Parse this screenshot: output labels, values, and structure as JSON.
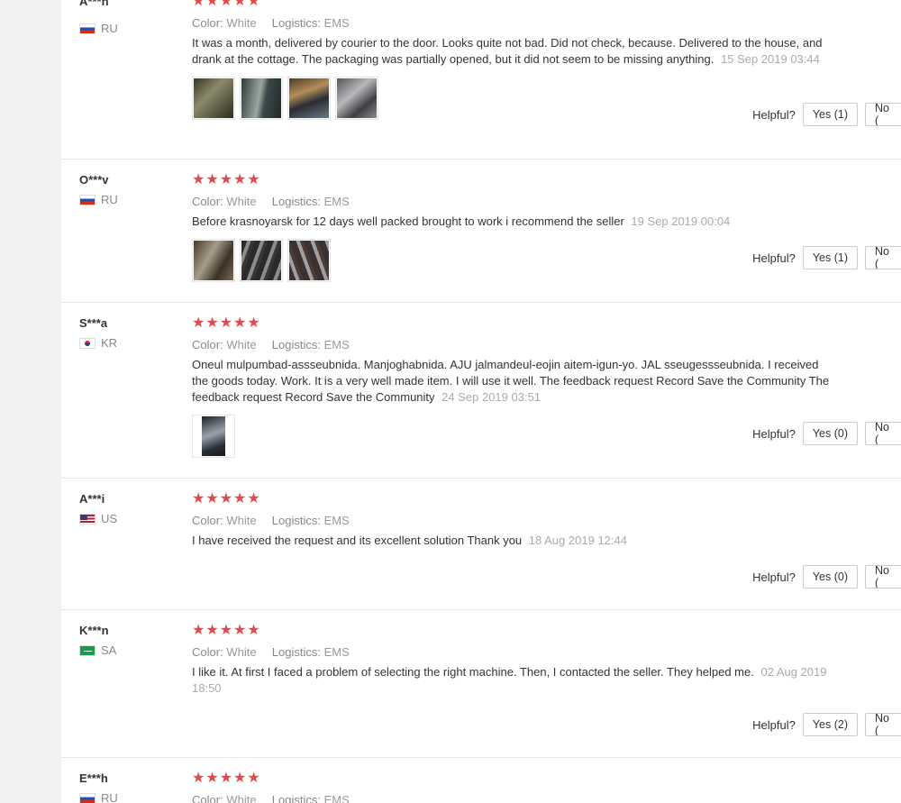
{
  "reviews": [
    {
      "user": "A***n",
      "country": "RU",
      "flag": "ru",
      "stars": "★★★★★",
      "color_label": "Color:",
      "color_value": "White",
      "logistics_label": "Logistics:",
      "logistics_value": "EMS",
      "text": "It was a month, delivered by courier to the door. Looks quite not bad. Did not check, because. Delivered to the house, and drank at the cottage. The packaging was partially opened, but it did not seem to be missing anything.",
      "date": "15 Sep 2019 03:44",
      "photos": 4,
      "helpful_label": "Helpful?",
      "yes": "Yes (1)",
      "no": "No ("
    },
    {
      "user": "O***v",
      "country": "RU",
      "flag": "ru",
      "stars": "★★★★★",
      "color_label": "Color:",
      "color_value": "White",
      "logistics_label": "Logistics:",
      "logistics_value": "EMS",
      "text": "Before krasnoyarsk for 12 days well packed brought to work i recommend the seller",
      "date": "19 Sep 2019 00:04",
      "photos": 3,
      "helpful_label": "Helpful?",
      "yes": "Yes (1)",
      "no": "No ("
    },
    {
      "user": "S***a",
      "country": "KR",
      "flag": "kr",
      "stars": "★★★★★",
      "color_label": "Color:",
      "color_value": "White",
      "logistics_label": "Logistics:",
      "logistics_value": "EMS",
      "text": "Oneul mulpumbad-assseubnida. Manjoghabnida. AJU jalmandeul-eojin aitem-igun-yo. JAL sseugessseubnida. I received the goods today. Work. It is a very well made item. I will use it well. The feedback request Record Save the Community The feedback request Record Save the Community",
      "date": "24 Sep 2019 03:51",
      "photos": 1,
      "helpful_label": "Helpful?",
      "yes": "Yes (0)",
      "no": "No ("
    },
    {
      "user": "A***i",
      "country": "US",
      "flag": "us",
      "stars": "★★★★★",
      "color_label": "Color:",
      "color_value": "White",
      "logistics_label": "Logistics:",
      "logistics_value": "EMS",
      "text": "I have received the request and its excellent solution Thank you",
      "date": "18 Aug 2019 12:44",
      "photos": 0,
      "helpful_label": "Helpful?",
      "yes": "Yes (0)",
      "no": "No ("
    },
    {
      "user": "K***n",
      "country": "SA",
      "flag": "sa",
      "stars": "★★★★★",
      "color_label": "Color:",
      "color_value": "White",
      "logistics_label": "Logistics:",
      "logistics_value": "EMS",
      "text": "I like it. At first I faced a problem of selecting the right machine. Then, I contacted the seller. They helped me.",
      "date": "02 Aug 2019 18:50",
      "photos": 0,
      "helpful_label": "Helpful?",
      "yes": "Yes (2)",
      "no": "No ("
    },
    {
      "user": "E***h",
      "country": "RU",
      "flag": "ru",
      "stars": "★★★★★",
      "color_label": "Color:",
      "color_value": "White",
      "logistics_label": "Logistics:",
      "logistics_value": "EMS"
    }
  ],
  "colors": {
    "star": "#e14a4a",
    "date": "#aaaaaa",
    "gutter": "#f2f2f2"
  }
}
